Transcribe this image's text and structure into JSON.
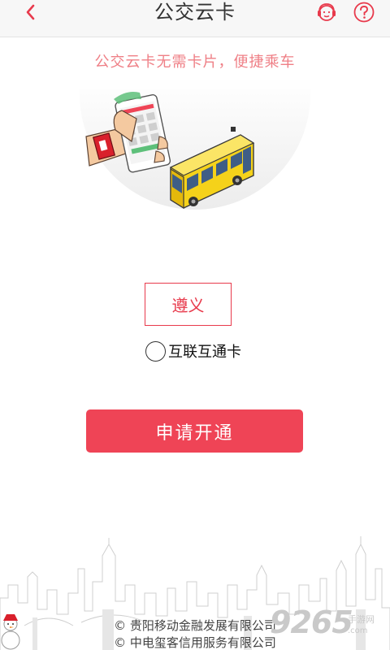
{
  "header": {
    "title": "公交云卡",
    "back_icon": "chevron-left-icon",
    "service_icon": "customer-service-icon",
    "help_icon": "question-mark-icon"
  },
  "slogan": "公交云卡无需卡片，便捷乘车",
  "hero": {
    "phone_icon": "phone-in-hand-illustration",
    "bus_icon": "yellow-bus-illustration"
  },
  "city_select": {
    "label": "遵义"
  },
  "interop_option": {
    "label": "互联互通卡",
    "checked": false
  },
  "apply_button": {
    "label": "申请开通"
  },
  "footer": {
    "line1": "© 贵阳移动金融发展有限公司",
    "line2": "© 中电玺客信用服务有限公司"
  },
  "watermark": {
    "number": "9265",
    "tag": "手游网",
    "url": ".com"
  },
  "colors": {
    "accent": "#ef4456",
    "select_border": "#e83a4c",
    "slogan": "#ef7f86",
    "header_bg": "#f7f7f7"
  }
}
